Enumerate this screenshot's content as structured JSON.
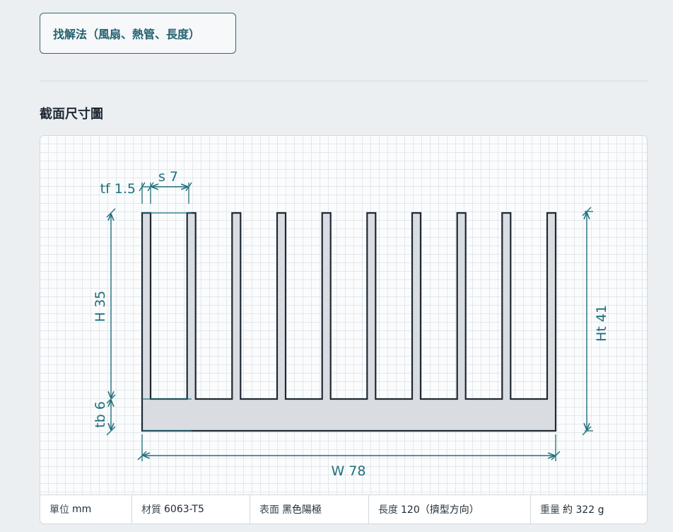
{
  "action_button": {
    "label": "找解法（風扇、熱管、長度）"
  },
  "section": {
    "title": "截面尺寸圖"
  },
  "diagram": {
    "fin_count": 10,
    "dims_mm": {
      "tf": 1.5,
      "s": 7,
      "H": 35,
      "Ht": 41,
      "tb": 6,
      "W": 78
    },
    "labels": {
      "tf": "tf 1.5",
      "s": "s 7",
      "H": "H 35",
      "Ht": "Ht 41",
      "tb": "tb 6",
      "W": "W 78"
    },
    "colors": {
      "dimension": "#1e6f7b",
      "profile_fill": "#d9dde2",
      "profile_stroke": "#1f2933"
    }
  },
  "specs": [
    {
      "key": "單位",
      "value": "mm"
    },
    {
      "key": "材質",
      "value": "6063-T5"
    },
    {
      "key": "表面",
      "value": "黑色陽極"
    },
    {
      "key": "長度",
      "value": "120（擠型方向）"
    },
    {
      "key": "重量",
      "value": "約 322 g"
    }
  ]
}
